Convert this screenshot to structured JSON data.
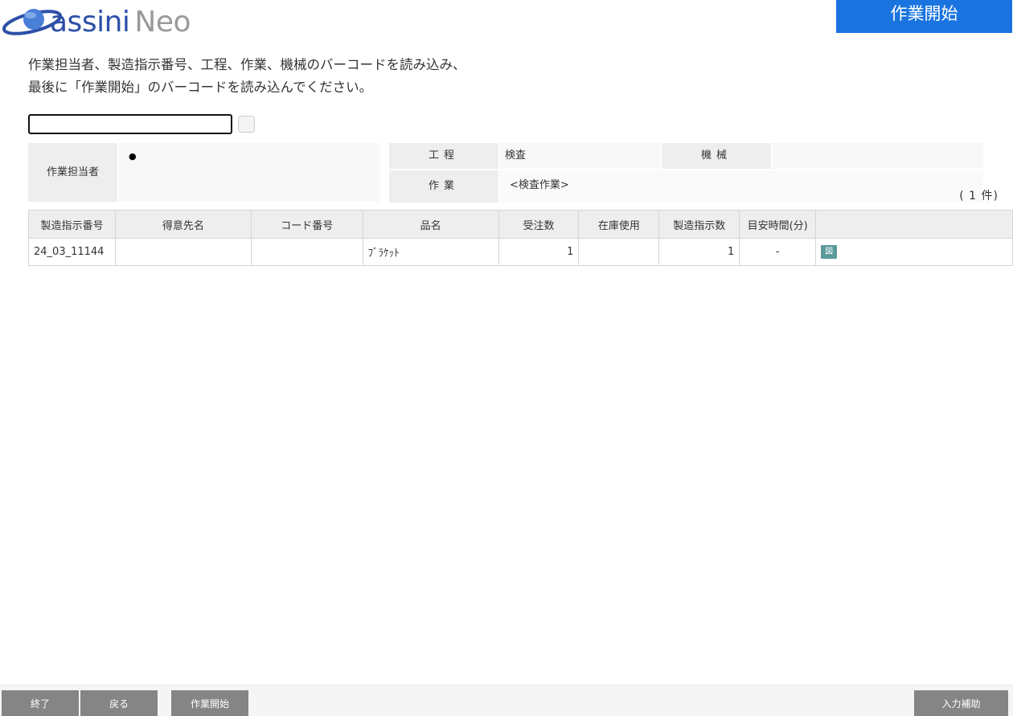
{
  "logo": {
    "text_assini": "assini",
    "text_neo": "Neo"
  },
  "header": {
    "title": "作業開始"
  },
  "instructions": {
    "line1": "作業担当者、製造指示番号、工程、作業、機械のバーコードを読み込み、",
    "line2": "最後に「作業開始」のバーコードを読み込んでください。"
  },
  "barcode": {
    "value": "",
    "placeholder": ""
  },
  "info": {
    "worker_label": "作業担当者",
    "worker_value": "",
    "process_label": "工程",
    "process_value": "検査",
    "machine_label": "機械",
    "machine_value": "",
    "task_label": "作業",
    "task_value": "<検査作業>"
  },
  "count": "( 1 件)",
  "table": {
    "headers": [
      "製造指示番号",
      "得意先名",
      "コード番号",
      "品名",
      "受注数",
      "在庫使用",
      "製造指示数",
      "目安時間(分)",
      ""
    ],
    "rows": [
      {
        "order_no": "24_03_11144",
        "customer": "",
        "code": "",
        "product": "ﾌﾞﾗｹｯﾄ",
        "ordered_qty": "1",
        "stock_used": "",
        "instructed_qty": "1",
        "est_time": "-",
        "drawing": "図"
      }
    ]
  },
  "footer": {
    "end": "終了",
    "back": "戻る",
    "start": "作業開始",
    "input_help": "入力補助"
  },
  "colors": {
    "accent": "#1a74e0",
    "button": "#858585",
    "drawing_icon": "#5a9a9a"
  }
}
